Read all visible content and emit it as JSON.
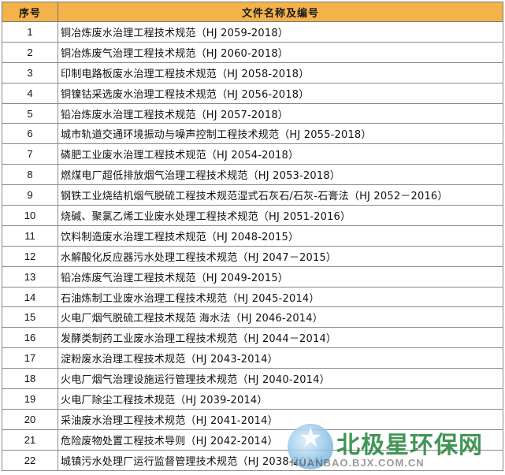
{
  "table": {
    "headers": [
      "序号",
      "文件名称及编号"
    ],
    "rows": [
      {
        "num": "1",
        "name": "铜冶炼废水治理工程技术规范（HJ 2059-2018）"
      },
      {
        "num": "2",
        "name": "铜冶炼废气治理工程技术规范（HJ 2060-2018）"
      },
      {
        "num": "3",
        "name": "印制电路板废水治理工程技术规范（HJ 2058-2018）"
      },
      {
        "num": "4",
        "name": "铜镍钴采选废水治理工程技术规范（HJ 2056-2018）"
      },
      {
        "num": "5",
        "name": "铅冶炼废水治理工程技术规范（HJ 2057-2018）"
      },
      {
        "num": "6",
        "name": "城市轨道交通环境振动与噪声控制工程技术规范（HJ 2055-2018）"
      },
      {
        "num": "7",
        "name": "磷肥工业废水治理工程技术规范（HJ 2054-2018）"
      },
      {
        "num": "8",
        "name": "燃煤电厂超低排放烟气治理工程技术规范（HJ 2053-2018）"
      },
      {
        "num": "9",
        "name": "钢铁工业烧结机烟气脱硫工程技术规范湿式石灰石/石灰-石膏法（HJ 2052－2016）"
      },
      {
        "num": "10",
        "name": "烧碱、聚氯乙烯工业废水处理工程技术规范（HJ 2051-2016）"
      },
      {
        "num": "11",
        "name": "饮料制造废水治理工程技术规范（HJ 2048-2015）"
      },
      {
        "num": "12",
        "name": "水解酸化反应器污水处理工程技术规范（HJ 2047－2015）"
      },
      {
        "num": "13",
        "name": "铅冶炼废气治理工程技术规范（HJ 2049-2015）"
      },
      {
        "num": "14",
        "name": "石油炼制工业废水治理工程技术规范（HJ 2045-2014）"
      },
      {
        "num": "15",
        "name": "火电厂烟气脱硫工程技术规范 海水法（HJ 2046-2014）"
      },
      {
        "num": "16",
        "name": "发酵类制药工业废水治理工程技术规范（HJ 2044－2014）"
      },
      {
        "num": "17",
        "name": "淀粉废水治理工程技术规范（HJ 2043-2014）"
      },
      {
        "num": "18",
        "name": "火电厂烟气治理设施运行管理技术规范（HJ 2040-2014）"
      },
      {
        "num": "19",
        "name": "火电厂除尘工程技术规范（HJ 2039-2014）"
      },
      {
        "num": "20",
        "name": "采油废水治理工程技术规范（HJ 2041-2014）"
      },
      {
        "num": "21",
        "name": "危险废物处置工程技术导则（HJ 2042-2014）"
      },
      {
        "num": "22",
        "name": "城镇污水处理厂运行监督管理技术规范（HJ 2038-2014）"
      }
    ]
  },
  "watermark": {
    "title": "北极星环保网",
    "url": "HUANBAO.BJX.COM.CN"
  },
  "colors": {
    "header_bg": "#f4b24a",
    "grid_line": "#8a8a8a",
    "watermark_green": "#2f8a45"
  }
}
